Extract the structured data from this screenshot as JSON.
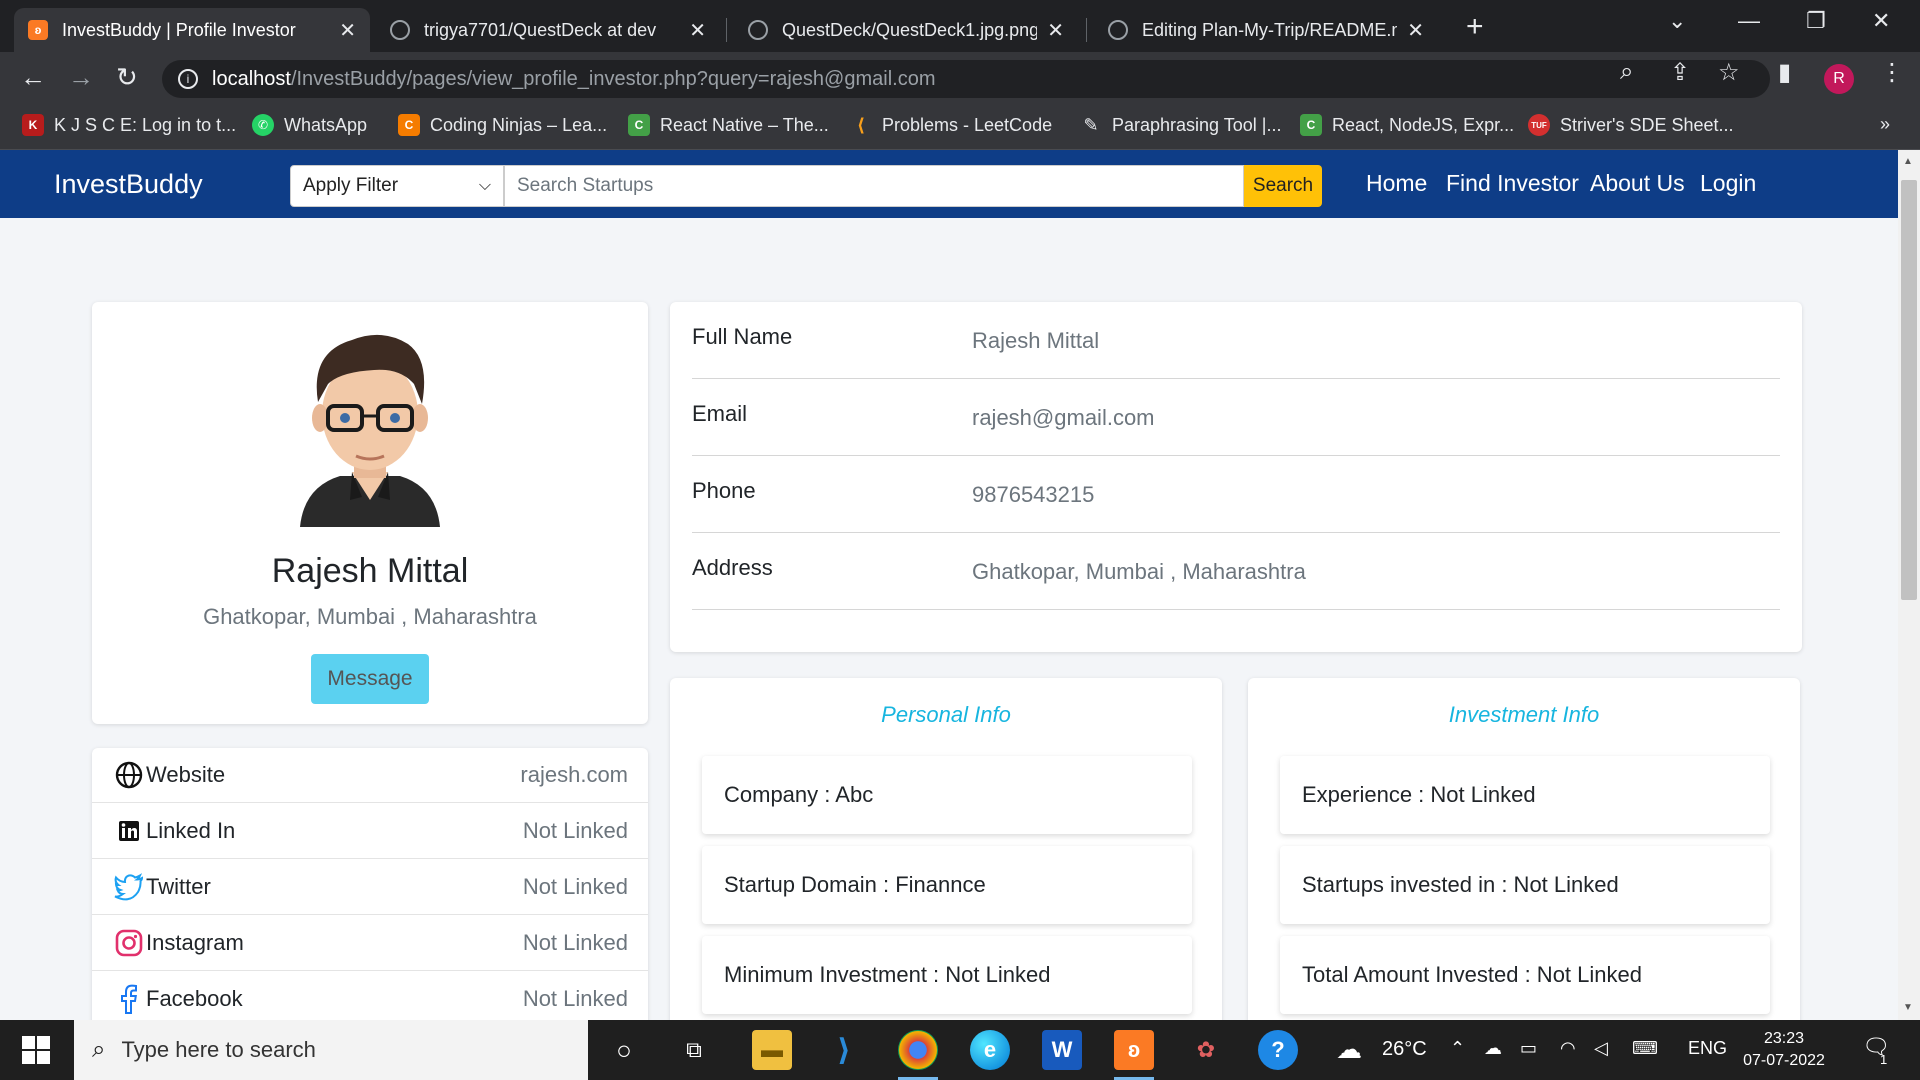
{
  "browser": {
    "tabs": [
      {
        "title": "InvestBuddy | Profile Investor",
        "active": true
      },
      {
        "title": "trigya7701/QuestDeck at dev",
        "active": false
      },
      {
        "title": "QuestDeck/QuestDeck1.jpg.png",
        "active": false
      },
      {
        "title": "Editing Plan-My-Trip/README.m",
        "active": false
      }
    ],
    "url_host": "localhost",
    "url_path": "/InvestBuddy/pages/view_profile_investor.php?query=rajesh@gmail.com",
    "profile_initial": "R",
    "bookmarks": [
      "K J S C E: Log in to t...",
      "WhatsApp",
      "Coding Ninjas – Lea...",
      "React Native – The...",
      "Problems - LeetCode",
      "Paraphrasing Tool |...",
      "React, NodeJS, Expr...",
      "Striver's SDE Sheet..."
    ]
  },
  "site": {
    "brand": "InvestBuddy",
    "filter_label": "Apply Filter",
    "search_placeholder": "Search Startups",
    "search_button": "Search",
    "nav": [
      "Home",
      "Find Investor",
      "About Us",
      "Login"
    ]
  },
  "profile": {
    "name": "Rajesh Mittal",
    "address": "Ghatkopar, Mumbai , Maharashtra",
    "message_button": "Message"
  },
  "social": [
    {
      "label": "Website",
      "value": "rajesh.com",
      "icon": "globe-icon"
    },
    {
      "label": "Linked In",
      "value": "Not Linked",
      "icon": "linkedin-icon"
    },
    {
      "label": "Twitter",
      "value": "Not Linked",
      "icon": "twitter-icon"
    },
    {
      "label": "Instagram",
      "value": "Not Linked",
      "icon": "instagram-icon"
    },
    {
      "label": "Facebook",
      "value": "Not Linked",
      "icon": "facebook-icon"
    }
  ],
  "details": [
    {
      "label": "Full Name",
      "value": "Rajesh Mittal"
    },
    {
      "label": "Email",
      "value": "rajesh@gmail.com"
    },
    {
      "label": "Phone",
      "value": "9876543215"
    },
    {
      "label": "Address",
      "value": "Ghatkopar, Mumbai , Maharashtra"
    }
  ],
  "personal_info": {
    "heading": "Personal Info",
    "items": [
      "Company : Abc",
      "Startup Domain : Finannce",
      "Minimum Investment : Not Linked"
    ]
  },
  "investment_info": {
    "heading": "Investment Info",
    "items": [
      "Experience : Not Linked",
      "Startups invested in : Not Linked",
      "Total Amount Invested : Not Linked"
    ]
  },
  "taskbar": {
    "search_placeholder": "Type here to search",
    "weather": "26°C",
    "language": "ENG",
    "time": "23:23",
    "date": "07-07-2022",
    "notification_count": "1"
  },
  "colors": {
    "navbar": "#0e3d87",
    "search_button": "#ffc107",
    "message_button": "#5bd1f0",
    "section_heading": "#17b5df"
  }
}
